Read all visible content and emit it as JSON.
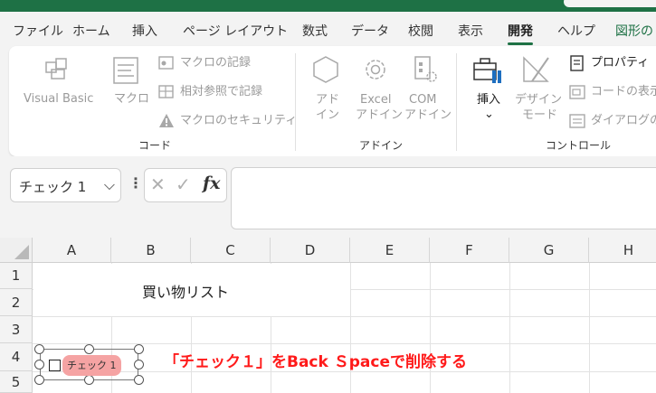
{
  "menu": {
    "items": [
      "ファイル",
      "ホーム",
      "挿入",
      "ページ レイアウト",
      "数式",
      "データ",
      "校閲",
      "表示",
      "開発",
      "ヘルプ",
      "図形の"
    ],
    "active_index": 8
  },
  "ribbon": {
    "code": {
      "visual_basic": "Visual Basic",
      "macro": "マクロ",
      "record_macro": "マクロの記録",
      "relative_ref": "相対参照で記録",
      "macro_security": "マクロのセキュリティ",
      "group_label": "コード"
    },
    "addins": {
      "addin_1": "アド",
      "addin_2": "イン",
      "excel_1": "Excel",
      "excel_2": "アドイン",
      "com_1": "COM",
      "com_2": "アドイン",
      "group_label": "アドイン"
    },
    "controls": {
      "insert": "挿入",
      "insert_arrow": "⌄",
      "design_1": "デザイン",
      "design_2": "モード",
      "properties": "プロパティ",
      "view_code": "コードの表示",
      "run_dialog": "ダイアログの実",
      "group_label": "コントロール"
    }
  },
  "formula_bar": {
    "name_box": "チェック 1",
    "name_box_arrow": "⌵",
    "vdots": "⋮",
    "cancel": "✕",
    "enter": "✓",
    "fx": "fx",
    "value": ""
  },
  "grid": {
    "columns": [
      "A",
      "B",
      "C",
      "D",
      "E",
      "F",
      "G",
      "H"
    ],
    "rows": [
      "1",
      "2",
      "3",
      "4",
      "5"
    ],
    "title_cell": "買い物リスト"
  },
  "checkbox": {
    "label": "チェック 1"
  },
  "annotation": "「チェック１」をBack Ｓpaceで削除する",
  "colors": {
    "excel_green": "#1e7145",
    "annotation_red": "#ff1a1a",
    "label_highlight": "#f5a3a3"
  }
}
